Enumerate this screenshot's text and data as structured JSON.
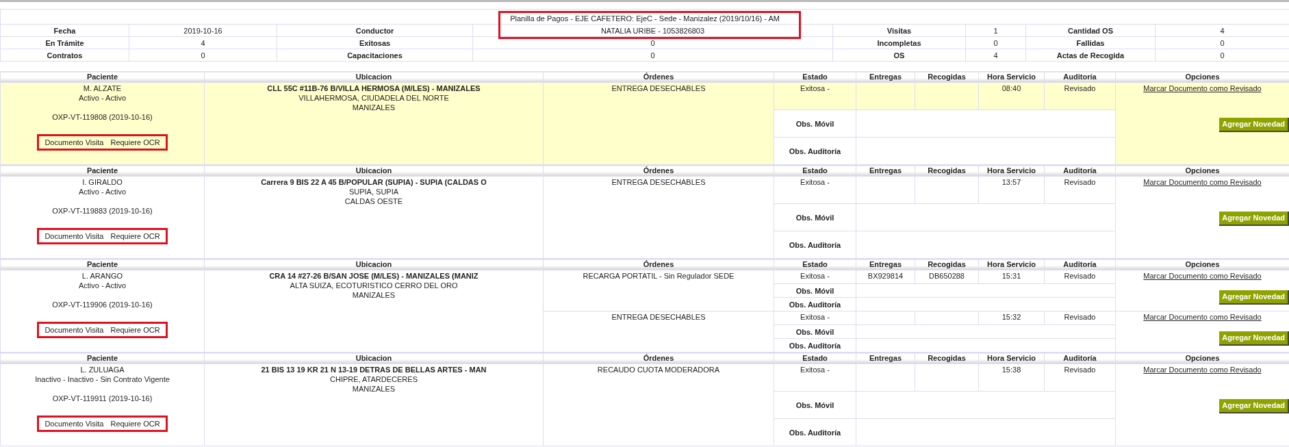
{
  "title": {
    "text": "Planilla de Pagos - EJE CAFETERO: EjeC - Sede - Manizalez (2019/10/16) - AM",
    "marked": true
  },
  "summary": [
    [
      {
        "label": "Fecha",
        "value": "2019-10-16"
      },
      {
        "label": "Conductor",
        "value": "NATALIA URIBE - 1053826803"
      },
      {
        "label": "Visitas",
        "value": "1"
      },
      {
        "label": "Cantidad OS",
        "value": "4"
      }
    ],
    [
      {
        "label": "En Trámite",
        "value": "4"
      },
      {
        "label": "Exitosas",
        "value": "0"
      },
      {
        "label": "Incompletas",
        "value": "0"
      },
      {
        "label": "Fallidas",
        "value": "0"
      }
    ],
    [
      {
        "label": "Contratos",
        "value": "0"
      },
      {
        "label": "Capacitaciones",
        "value": "0"
      },
      {
        "label": "OS",
        "value": "4"
      },
      {
        "label": "Actas de Recogida",
        "value": "0"
      }
    ]
  ],
  "visits": [
    {
      "columns": [
        "Paciente",
        "Ubicacion",
        "Órdenes",
        "Estado",
        "Entregas",
        "Recogidas",
        "Hora Servicio",
        "Auditoría",
        "Opciones"
      ],
      "highlighted": true,
      "patient": "M. ALZATE",
      "patient_status": "Activo - Activo",
      "visit_code": "OXP-VT-119808 (2019-10-16)",
      "documents": [
        "Documento Visita",
        "Requiere OCR"
      ],
      "documents_marked": true,
      "address": "CLL 55C #11B-76 B/VILLA HERMOSA (M/LES) - MANIZALES",
      "neighborhood": "VILLAHERMOSA, CIUDADELA DEL NORTE",
      "city": "MANIZALES",
      "orders": [
        {
          "order": "ENTREGA DESECHABLES",
          "estado": "Exitosa -",
          "hora": "08:40",
          "auditoria": "Revisado",
          "obs_movil": "Obs. Móvil",
          "obs_auditoria": "Obs. Auditoría",
          "link": "Marcar Documento como Revisado",
          "button": "Agregar Novedad"
        }
      ]
    },
    {
      "columns": [
        "Paciente",
        "Ubicacion",
        "Órdenes",
        "Estado",
        "Entregas",
        "Recogidas",
        "Hora Servicio",
        "Auditoría",
        "Opciones"
      ],
      "highlighted": false,
      "patient": "I. GIRALDO",
      "patient_status": "Activo - Activo",
      "visit_code": "OXP-VT-119883 (2019-10-16)",
      "documents": [
        "Documento Visita",
        "Requiere OCR"
      ],
      "documents_marked": true,
      "address": "Carrera 9 BIS 22 A 45 B/POPULAR (SUPIA) - SUPIA (CALDAS O",
      "neighborhood": "SUPIA, SUPIA",
      "city": "CALDAS OESTE",
      "orders": [
        {
          "order": "ENTREGA DESECHABLES",
          "estado": "Exitosa -",
          "hora": "13:57",
          "auditoria": "Revisado",
          "obs_movil": "Obs. Móvil",
          "obs_auditoria": "Obs. Auditoría",
          "link": "Marcar Documento como Revisado",
          "button": "Agregar Novedad"
        }
      ]
    },
    {
      "columns": [
        "Paciente",
        "Ubicacion",
        "Órdenes",
        "Estado",
        "Entregas",
        "Recogidas",
        "Hora Servicio",
        "Auditoría",
        "Opciones"
      ],
      "highlighted": false,
      "patient": "L. ARANGO",
      "patient_status": "Activo - Activo",
      "visit_code": "OXP-VT-119906 (2019-10-16)",
      "documents": [
        "Documento Visita",
        "Requiere OCR"
      ],
      "documents_marked": true,
      "address": "CRA 14 #27-26 B/SAN JOSE (M/LES) - MANIZALES (MANIZ",
      "neighborhood": "ALTA SUIZA, ECOTURISTICO CERRO DEL ORO",
      "city": "MANIZALES",
      "orders": [
        {
          "order": "RECARGA PORTATIL - Sin Regulador SEDE",
          "estado": "Exitosa -",
          "entregas": "BX929814",
          "recogidas": "DB650288",
          "hora": "15:31",
          "auditoria": "Revisado",
          "obs_movil": "Obs. Móvil",
          "obs_auditoria": "Obs. Auditoría",
          "link": "Marcar Documento como Revisado",
          "button": "Agregar Novedad"
        },
        {
          "order": "ENTREGA DESECHABLES",
          "estado": "Exitosa -",
          "hora": "15:32",
          "auditoria": "Revisado",
          "obs_movil": "Obs. Móvil",
          "obs_auditoria": "Obs. Auditoría",
          "link": "Marcar Documento como Revisado",
          "button": "Agregar Novedad"
        }
      ]
    },
    {
      "columns": [
        "Paciente",
        "Ubicacion",
        "Órdenes",
        "Estado",
        "Entregas",
        "Recogidas",
        "Hora Servicio",
        "Auditoría",
        "Opciones"
      ],
      "highlighted": false,
      "patient": "L. ZULUAGA",
      "patient_status": "Inactivo - Inactivo - Sin Contrato Vigente",
      "visit_code": "OXP-VT-119911 (2019-10-16)",
      "documents": [
        "Documento Visita",
        "Requiere OCR"
      ],
      "documents_marked": true,
      "address": "21 BIS 13 19 KR 21 N 13-19 DETRAS DE BELLAS ARTES - MAN",
      "neighborhood": "CHIPRE, ATARDECERES",
      "city": "MANIZALES",
      "orders": [
        {
          "order": "RECAUDO CUOTA MODERADORA",
          "estado": "Exitosa -",
          "hora": "15:38",
          "auditoria": "Revisado",
          "obs_movil": "Obs. Móvil",
          "obs_auditoria": "Obs. Auditoría",
          "link": "Marcar Documento como Revisado",
          "button": "Agregar Novedad"
        }
      ]
    }
  ]
}
